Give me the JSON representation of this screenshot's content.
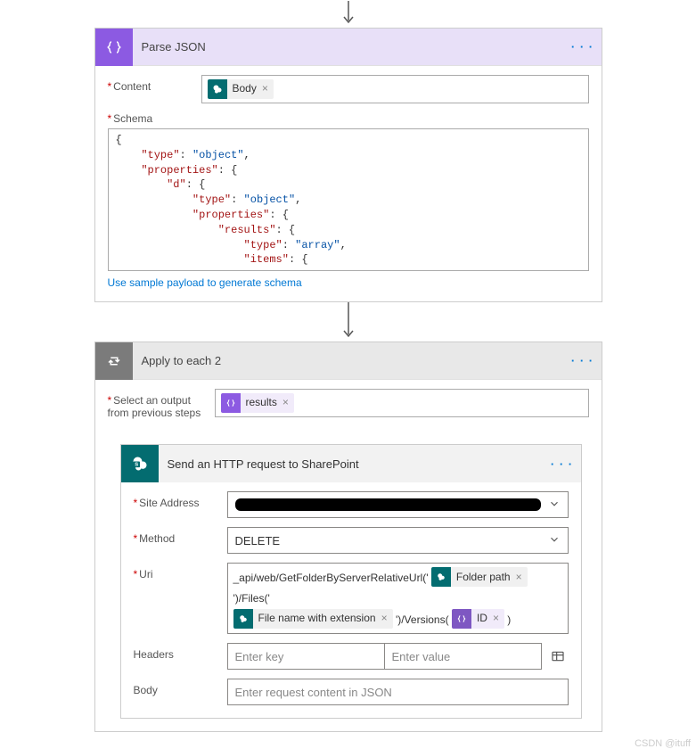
{
  "arrow_glyph": "↓",
  "parse_json": {
    "title": "Parse JSON",
    "content_label": "Content",
    "content_token": "Body",
    "schema_label": "Schema",
    "schema_lines": [
      [
        "{"
      ],
      [
        "    ",
        [
          "key",
          "\"type\""
        ],
        ": ",
        [
          "str",
          "\"object\""
        ],
        ","
      ],
      [
        "    ",
        [
          "key",
          "\"properties\""
        ],
        ": {"
      ],
      [
        "        ",
        [
          "key",
          "\"d\""
        ],
        ": {"
      ],
      [
        "            ",
        [
          "key",
          "\"type\""
        ],
        ": ",
        [
          "str",
          "\"object\""
        ],
        ","
      ],
      [
        "            ",
        [
          "key",
          "\"properties\""
        ],
        ": {"
      ],
      [
        "                ",
        [
          "key",
          "\"results\""
        ],
        ": {"
      ],
      [
        "                    ",
        [
          "key",
          "\"type\""
        ],
        ": ",
        [
          "str",
          "\"array\""
        ],
        ","
      ],
      [
        "                    ",
        [
          "key",
          "\"items\""
        ],
        ": {"
      ],
      [
        "                        "
      ]
    ],
    "sample_link": "Use sample payload to generate schema"
  },
  "apply": {
    "title": "Apply to each 2",
    "select_label": "Select an output from previous steps",
    "select_token": "results"
  },
  "http": {
    "title": "Send an HTTP request to SharePoint",
    "site_addr_label": "Site Address",
    "method_label": "Method",
    "method_value": "DELETE",
    "uri_label": "Uri",
    "uri_parts": {
      "p1": "_api/web/GetFolderByServerRelativeUrl('",
      "t1": "Folder path",
      "p2": "')/Files('",
      "t2": "File name with extension",
      "p3": "')/Versions(",
      "t3": "ID",
      "p4": ")"
    },
    "headers_label": "Headers",
    "header_key_ph": "Enter key",
    "header_val_ph": "Enter value",
    "body_label": "Body",
    "body_ph": "Enter request content in JSON"
  },
  "watermark": "CSDN @ituff",
  "more_glyph": "· · ·",
  "chevron": "⌄"
}
